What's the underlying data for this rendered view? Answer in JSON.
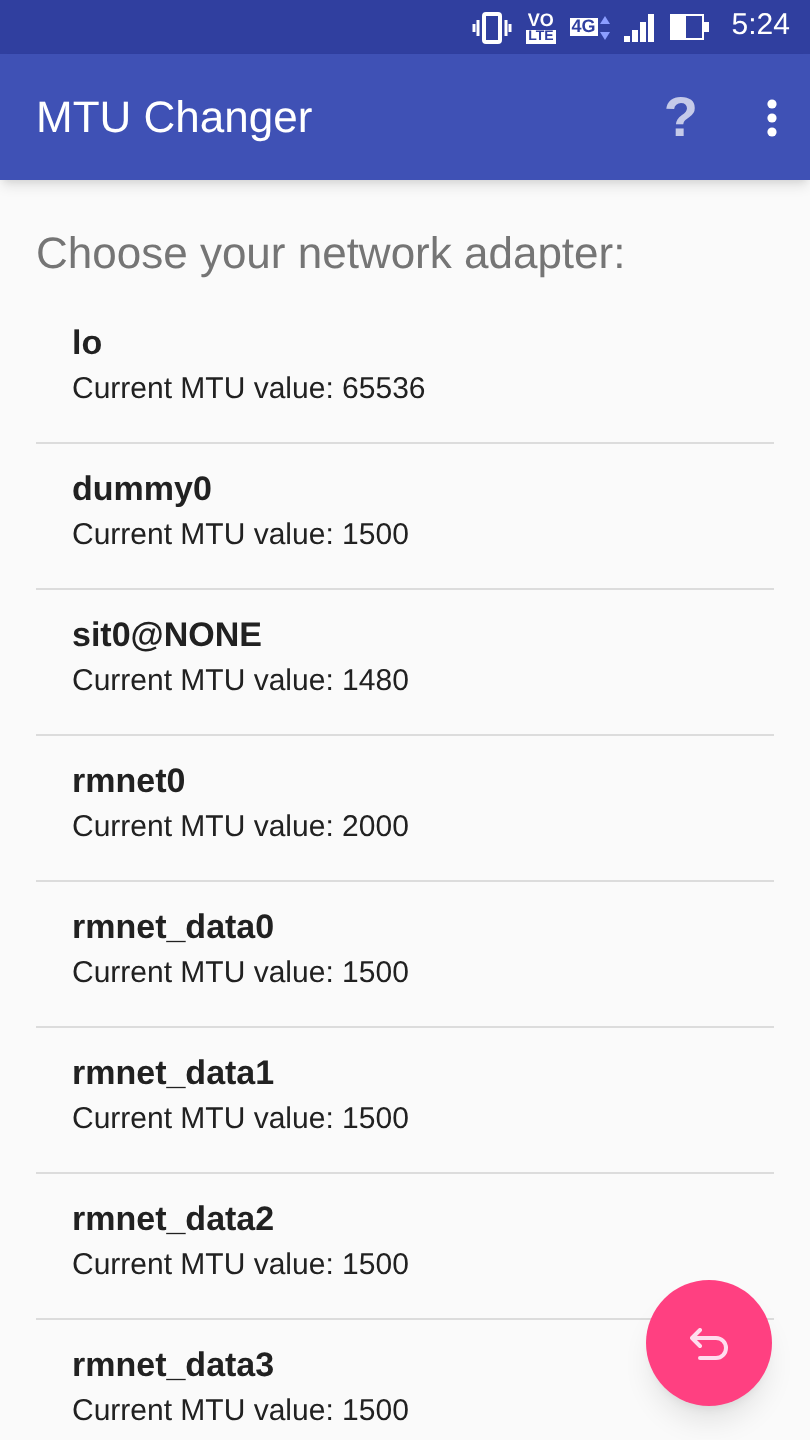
{
  "status_bar": {
    "volte_top": "VO",
    "volte_bottom": "LTE",
    "network": "4G",
    "time": "5:24"
  },
  "app_bar": {
    "title": "MTU Changer",
    "help": "?"
  },
  "heading": "Choose your network adapter:",
  "adapters": [
    {
      "name": "lo",
      "mtu": "Current MTU value: 65536"
    },
    {
      "name": "dummy0",
      "mtu": "Current MTU value: 1500"
    },
    {
      "name": "sit0@NONE",
      "mtu": "Current MTU value: 1480"
    },
    {
      "name": "rmnet0",
      "mtu": "Current MTU value: 2000"
    },
    {
      "name": "rmnet_data0",
      "mtu": "Current MTU value: 1500"
    },
    {
      "name": "rmnet_data1",
      "mtu": "Current MTU value: 1500"
    },
    {
      "name": "rmnet_data2",
      "mtu": "Current MTU value: 1500"
    },
    {
      "name": "rmnet_data3",
      "mtu": "Current MTU value: 1500"
    }
  ]
}
